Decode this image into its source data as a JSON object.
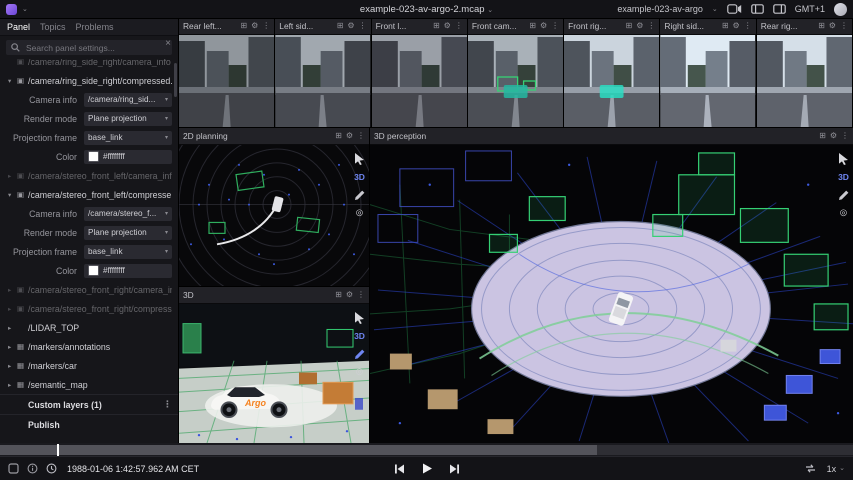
{
  "topbar": {
    "title": "example-023-av-argo-2.mcap",
    "layout": "example-023-av-argo",
    "timezone": "GMT+1"
  },
  "icons": {
    "chevron": "⌄",
    "caret": "▾",
    "gear": "⚙",
    "more": "⋮",
    "split": "⊞",
    "close": "×",
    "target": "◎"
  },
  "sidebar": {
    "tabs": [
      {
        "label": "Panel",
        "cls": "active"
      },
      {
        "label": "Topics",
        "cls": ""
      },
      {
        "label": "Problems",
        "cls": ""
      }
    ],
    "search_placeholder": "Search panel settings...",
    "rows": [
      {
        "cls": "topic dim cut",
        "arrow": "",
        "icon": "▣",
        "label": "/camera/ring_side_right/camera_info",
        "value": "",
        "more": ""
      },
      {
        "cls": "topic",
        "arrow": "▾",
        "icon": "▣",
        "label": "/camera/ring_side_right/compressed...",
        "value": "",
        "more": ""
      },
      {
        "cls": "setting dd",
        "arrow": "",
        "icon": "",
        "label": "Camera info",
        "value": "/camera/ring_sid...",
        "more": ""
      },
      {
        "cls": "setting dd",
        "arrow": "",
        "icon": "",
        "label": "Render mode",
        "value": "Plane projection",
        "more": ""
      },
      {
        "cls": "setting dd",
        "arrow": "",
        "icon": "",
        "label": "Projection frame",
        "value": "base_link",
        "more": ""
      },
      {
        "cls": "setting colorv",
        "arrow": "",
        "icon": "",
        "label": "Color",
        "value": "#ffffffff",
        "more": ""
      },
      {
        "cls": "topic dim",
        "arrow": "▸",
        "icon": "▣",
        "label": "/camera/stereo_front_left/camera_info",
        "value": "",
        "more": ""
      },
      {
        "cls": "topic",
        "arrow": "▾",
        "icon": "▣",
        "label": "/camera/stereo_front_left/compresse...",
        "value": "",
        "more": ""
      },
      {
        "cls": "setting dd",
        "arrow": "",
        "icon": "",
        "label": "Camera info",
        "value": "/camera/stereo_f...",
        "more": ""
      },
      {
        "cls": "setting dd",
        "arrow": "",
        "icon": "",
        "label": "Render mode",
        "value": "Plane projection",
        "more": ""
      },
      {
        "cls": "setting dd",
        "arrow": "",
        "icon": "",
        "label": "Projection frame",
        "value": "base_link",
        "more": ""
      },
      {
        "cls": "setting colorv",
        "arrow": "",
        "icon": "",
        "label": "Color",
        "value": "#ffffffff",
        "more": ""
      },
      {
        "cls": "topic dim",
        "arrow": "▸",
        "icon": "▣",
        "label": "/camera/stereo_front_right/camera_in...",
        "value": "",
        "more": ""
      },
      {
        "cls": "topic dim",
        "arrow": "▸",
        "icon": "▣",
        "label": "/camera/stereo_front_right/compress...",
        "value": "",
        "more": ""
      },
      {
        "cls": "topic",
        "arrow": "▸",
        "icon": "",
        "label": "/LIDAR_TOP",
        "value": "",
        "more": ""
      },
      {
        "cls": "topic",
        "arrow": "▸",
        "icon": "▦",
        "label": "/markers/annotations",
        "value": "",
        "more": ""
      },
      {
        "cls": "topic",
        "arrow": "▸",
        "icon": "▦",
        "label": "/markers/car",
        "value": "",
        "more": ""
      },
      {
        "cls": "topic",
        "arrow": "▸",
        "icon": "▦",
        "label": "/semantic_map",
        "value": "",
        "more": ""
      },
      {
        "cls": "section",
        "arrow": "",
        "icon": "",
        "label": "Custom layers (1)",
        "value": "",
        "more": "⋮"
      },
      {
        "cls": "section",
        "arrow": "",
        "icon": "",
        "label": "Publish",
        "value": "",
        "more": ""
      }
    ]
  },
  "cameras": [
    {
      "title": "Rear left...",
      "cls": "cam0"
    },
    {
      "title": "Left sid...",
      "cls": "cam1"
    },
    {
      "title": "Front l...",
      "cls": "cam2"
    },
    {
      "title": "Front cam...",
      "cls": "cam3"
    },
    {
      "title": "Front rig...",
      "cls": "cam4"
    },
    {
      "title": "Right sid...",
      "cls": "cam5"
    },
    {
      "title": "Rear rig...",
      "cls": "cam6"
    }
  ],
  "panels": {
    "planning": "2D planning",
    "perception": "3D perception",
    "model": "3D",
    "tool3d": "3D",
    "car_logo": "Argo"
  },
  "playback": {
    "timestamp": "1988-01-06 1:42:57.962 AM CET",
    "speed": "1x"
  }
}
